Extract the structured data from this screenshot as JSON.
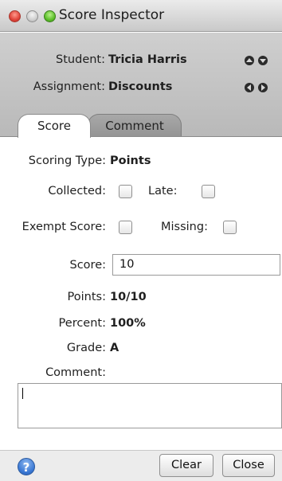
{
  "window": {
    "title": "Score Inspector"
  },
  "header": {
    "student_label": "Student:",
    "student_value": "Tricia Harris",
    "assignment_label": "Assignment:",
    "assignment_value": "Discounts"
  },
  "tabs": [
    {
      "label": "Score",
      "active": true
    },
    {
      "label": "Comment",
      "active": false
    }
  ],
  "form": {
    "scoring_type_label": "Scoring Type:",
    "scoring_type_value": "Points",
    "collected_label": "Collected:",
    "collected_checked": false,
    "late_label": "Late:",
    "late_checked": false,
    "exempt_label": "Exempt Score:",
    "exempt_checked": false,
    "missing_label": "Missing:",
    "missing_checked": false,
    "score_label": "Score:",
    "score_value": "10",
    "points_label": "Points:",
    "points_value": "10/10",
    "percent_label": "Percent:",
    "percent_value": "100%",
    "grade_label": "Grade:",
    "grade_value": "A",
    "comment_label": "Comment:",
    "comment_value": ""
  },
  "footer": {
    "help_icon": "?",
    "clear_label": "Clear",
    "close_label": "Close"
  },
  "icons": {
    "close": "close-icon",
    "minimize": "minimize-icon",
    "maximize": "maximize-icon",
    "prev_student": "triangle-up-icon",
    "next_student": "triangle-down-icon",
    "prev_assignment": "triangle-left-icon",
    "next_assignment": "triangle-right-icon",
    "help": "question-icon"
  }
}
